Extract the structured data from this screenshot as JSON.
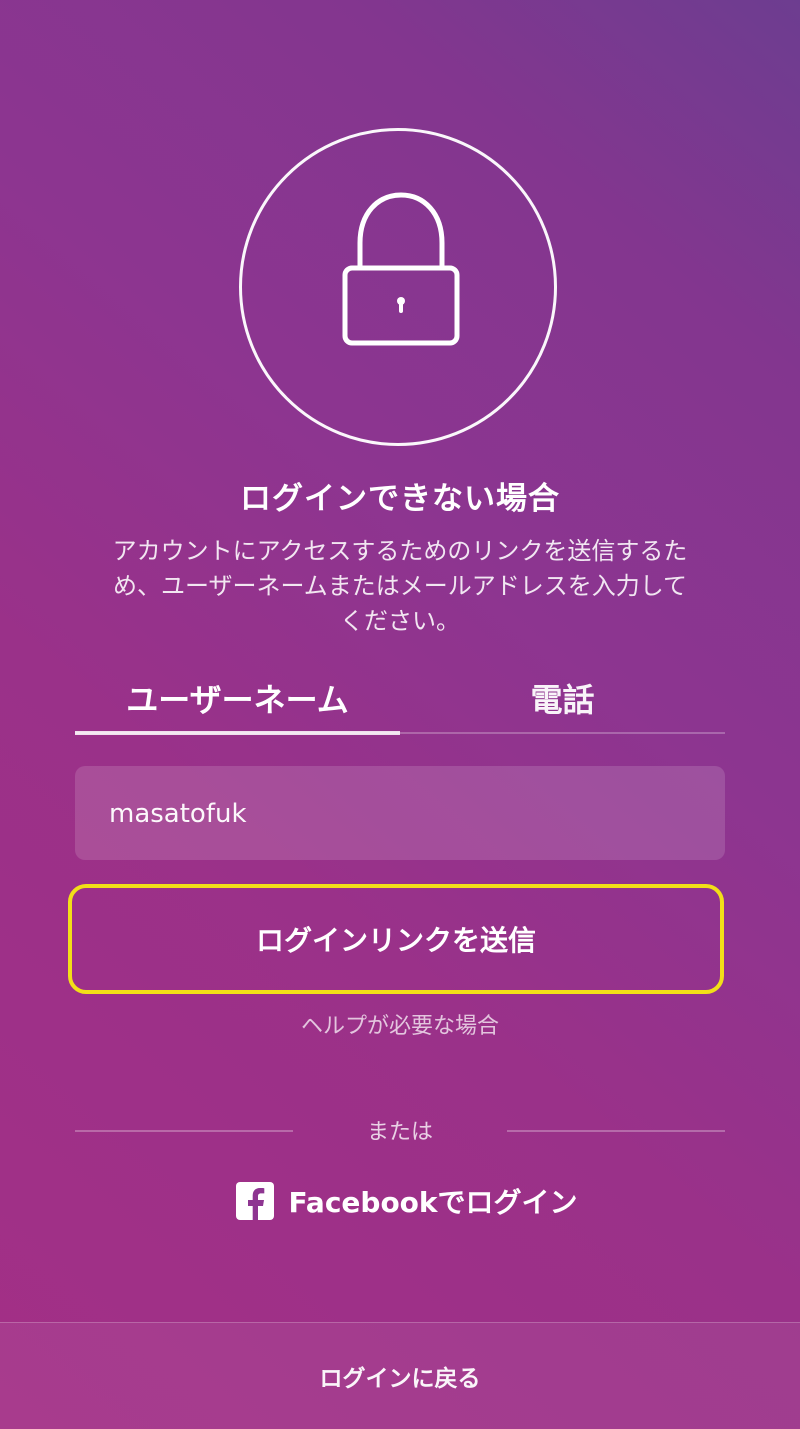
{
  "header": {
    "title": "ログインできない場合",
    "description": "アカウントにアクセスするためのリンクを送信するため、ユーザーネームまたはメールアドレスを入力してください。"
  },
  "tabs": {
    "username": "ユーザーネーム",
    "phone": "電話",
    "active": "username"
  },
  "form": {
    "username_value": "masatofuk",
    "submit_label": "ログインリンクを送信",
    "help_label": "ヘルプが必要な場合"
  },
  "divider": {
    "label": "または"
  },
  "facebook": {
    "label": "Facebookでログイン",
    "icon": "facebook-icon"
  },
  "footer": {
    "back_label": "ログインに戻る"
  },
  "icons": {
    "lock": "lock-icon"
  },
  "colors": {
    "background_start": "#a32f86",
    "background_end": "#6d3d90",
    "button_highlight": "#f2df18",
    "text": "#ffffff"
  }
}
